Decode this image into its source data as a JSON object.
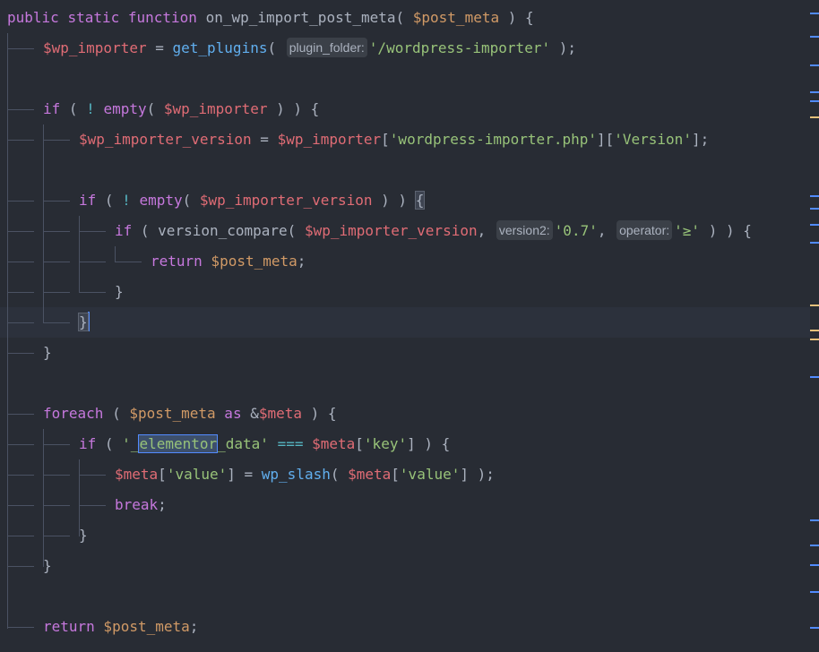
{
  "editor": {
    "language": "php",
    "colors": {
      "background": "#282c34",
      "current_line": "#2c313c",
      "keyword": "#c678dd",
      "function": "#61afef",
      "variable": "#e06c75",
      "string": "#98c379",
      "caret": "#528bff"
    },
    "lines": {
      "l1": {
        "kw1": "public",
        "kw2": "static",
        "kw3": "function",
        "name": "on_wp_import_post_meta",
        "open": "( ",
        "param": "$post_meta",
        "close": " ) {"
      },
      "l2": {
        "var": "$wp_importer",
        "eq": " = ",
        "fn": "get_plugins",
        "open": "( ",
        "hint": "plugin_folder:",
        "arg": "'/wordpress-importer'",
        "close": " );"
      },
      "l4": {
        "kw": "if",
        "p1": " ( ",
        "not": "!",
        "fn": " empty",
        "p2": "( ",
        "var": "$wp_importer",
        "p3": " ) ) {"
      },
      "l5": {
        "var": "$wp_importer_version",
        "eq": " = ",
        "var2": "$wp_importer",
        "b1": "[",
        "k1": "'wordpress-importer.php'",
        "b2": "][",
        "k2": "'Version'",
        "b3": "];"
      },
      "l7": {
        "kw": "if",
        "p1": " ( ",
        "not": "!",
        "fn": " empty",
        "p2": "( ",
        "var": "$wp_importer_version",
        "p3": " ) ) ",
        "brace": "{"
      },
      "l8": {
        "kw": "if",
        "p1": " ( ",
        "fn": "version_compare",
        "p2": "( ",
        "var": "$wp_importer_version",
        "comma1": ", ",
        "hint1": "version2:",
        "arg1": "'0.7'",
        "comma2": ", ",
        "hint2": "operator:",
        "arg2": "'≥'",
        "p3": " ) ) {"
      },
      "l9": {
        "kw": "return",
        "var": " $post_meta",
        "semi": ";"
      },
      "l10": {
        "brace": "}"
      },
      "l11": {
        "brace": "}"
      },
      "l12": {
        "brace": "}"
      },
      "l14": {
        "kw": "foreach",
        "p1": " ( ",
        "var": "$post_meta",
        "as": " as ",
        "amp": "&",
        "var2": "$meta",
        "p2": " ) {"
      },
      "l15": {
        "kw": "if",
        "p1": " ( ",
        "str_a": "'_",
        "str_sel": "elementor",
        "str_b": "_data'",
        "op": " === ",
        "var": "$meta",
        "b1": "[",
        "key": "'key'",
        "b2": "] ) {"
      },
      "l16": {
        "var": "$meta",
        "b1": "[",
        "key": "'value'",
        "b2": "] = ",
        "fn": "wp_slash",
        "p1": "( ",
        "var2": "$meta",
        "b3": "[",
        "key2": "'value'",
        "b4": "] );"
      },
      "l17": {
        "kw": "break",
        "semi": ";"
      },
      "l18": {
        "brace": "}"
      },
      "l19": {
        "brace": "}"
      },
      "l21": {
        "kw": "return",
        "var": " $post_meta",
        "semi": ";"
      }
    }
  }
}
